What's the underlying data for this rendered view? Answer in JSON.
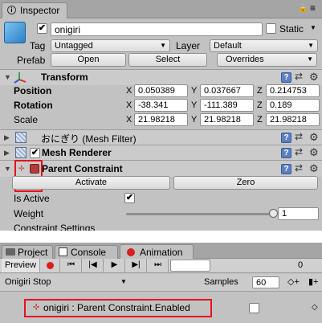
{
  "inspector": {
    "tab_label": "Inspector",
    "object_name": "onigiri",
    "active_check": "✔",
    "static_label": "Static",
    "tag_label": "Tag",
    "tag_value": "Untagged",
    "layer_label": "Layer",
    "layer_value": "Default",
    "prefab_label": "Prefab",
    "prefab_open": "Open",
    "prefab_select": "Select",
    "prefab_overrides": "Overrides"
  },
  "transform": {
    "title": "Transform",
    "position_label": "Position",
    "rotation_label": "Rotation",
    "scale_label": "Scale",
    "axes": [
      "X",
      "Y",
      "Z"
    ],
    "position": [
      "0.050389",
      "0.037667",
      "0.214753"
    ],
    "rotation": [
      "-38.341",
      "-111.389",
      "0.189"
    ],
    "scale": [
      "21.98218",
      "21.98218",
      "21.98218"
    ]
  },
  "components": {
    "mesh_filter": "おにぎり (Mesh Filter)",
    "mesh_renderer": "Mesh Renderer",
    "parent_constraint": "Parent Constraint",
    "check": "✔"
  },
  "constraint": {
    "activate_label": "Activate",
    "zero_label": "Zero",
    "is_active_label": "Is Active",
    "weight_label": "Weight",
    "weight_value": "1",
    "weight_fraction": 1.0,
    "settings_label": "Constraint Settings"
  },
  "bottom_tabs": {
    "project": "Project",
    "console": "Console",
    "animation": "Animation"
  },
  "animation": {
    "preview_label": "Preview",
    "clip_name": "Onigiri Stop",
    "samples_label": "Samples",
    "samples_value": "60",
    "time_zero": "0",
    "property_label": "onigiri : Parent Constraint.Enabled"
  },
  "colors": {
    "highlight_red": "#e8121c",
    "record_red": "#d61f1f",
    "help_blue": "#5b7fc2"
  }
}
